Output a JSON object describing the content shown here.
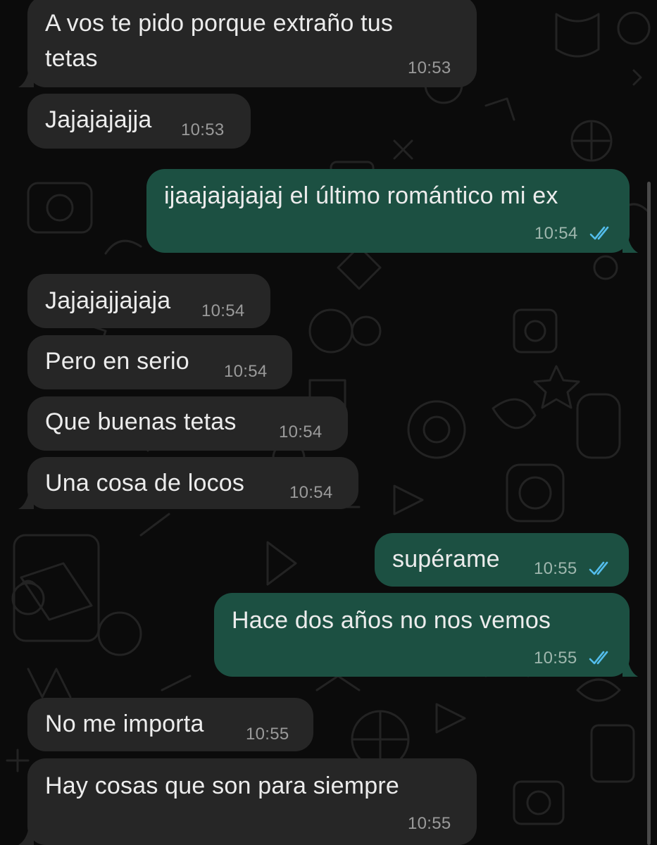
{
  "colors": {
    "background": "#0b0b0b",
    "incoming_bubble": "#262626",
    "outgoing_bubble": "#1c5042",
    "text": "#ececec",
    "timestamp": "#9a9a9a",
    "read_ticks": "#53bdeb"
  },
  "messages": [
    {
      "direction": "incoming",
      "text": "A vos te pido porque extraño tus\ntetas",
      "time": "10:53"
    },
    {
      "direction": "incoming",
      "text": "Jajajajajja",
      "time": "10:53"
    },
    {
      "direction": "outgoing",
      "text": "ijaajajajajaj el último romántico mi ex",
      "time": "10:54",
      "status_icon": "double-check-read-icon"
    },
    {
      "direction": "incoming",
      "text": "Jajajajjajaja",
      "time": "10:54"
    },
    {
      "direction": "incoming",
      "text": "Pero en serio",
      "time": "10:54"
    },
    {
      "direction": "incoming",
      "text": "Que buenas tetas",
      "time": "10:54"
    },
    {
      "direction": "incoming",
      "text": "Una cosa de locos",
      "time": "10:54"
    },
    {
      "direction": "outgoing",
      "text": "supérame",
      "time": "10:55",
      "status_icon": "double-check-read-icon"
    },
    {
      "direction": "outgoing",
      "text": "Hace dos años no nos vemos",
      "time": "10:55",
      "status_icon": "double-check-read-icon"
    },
    {
      "direction": "incoming",
      "text": "No me importa",
      "time": "10:55"
    },
    {
      "direction": "incoming",
      "text": "Hay cosas que son para siempre",
      "time": "10:55"
    }
  ]
}
